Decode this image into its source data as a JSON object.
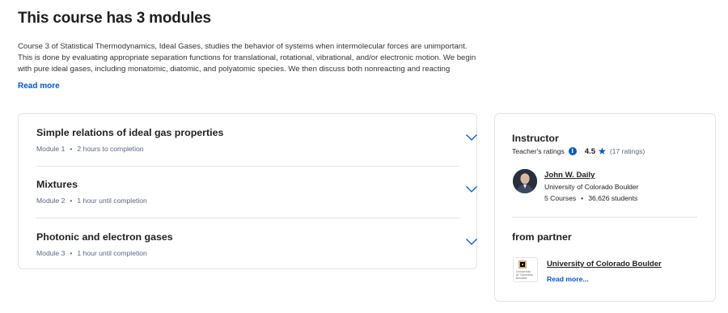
{
  "heading": {
    "title": "This course has 3 modules"
  },
  "description": {
    "text": "Course 3 of Statistical Thermodynamics, Ideal Gases, studies the behavior of systems when intermolecular forces are unimportant. This is done by evaluating appropriate separation functions for translational, rotational, vibrational, and/or electronic motion. We begin with pure ideal gases, including monatomic, diatomic, and polyatomic species. We then discuss both nonreacting and reacting mixtures of",
    "read_more": "Read more"
  },
  "modules": [
    {
      "title": "Simple relations of ideal gas properties",
      "number": "Module 1",
      "duration": "2 hours to completion"
    },
    {
      "title": "Mixtures",
      "number": "Module 2",
      "duration": "1 hour until completion"
    },
    {
      "title": "Photonic and electron gases",
      "number": "Module 3",
      "duration": "1 hour until completion"
    }
  ],
  "meta_separator": "•",
  "instructor": {
    "heading": "Instructor",
    "ratings_label": "Teacher's ratings",
    "rating_value": "4.5",
    "rating_count": "(17 ratings)",
    "name": "John W. Daily",
    "organization": "University of Colorado Boulder",
    "courses": "5 Courses",
    "students": "36,626 students"
  },
  "partner": {
    "heading": "from partner",
    "name": "University of Colorado Boulder",
    "read_more": "Read more...",
    "logo_line1": "University",
    "logo_line2": "of Colorado",
    "logo_line3": "Boulder"
  },
  "icons": {
    "chevron": "chevron-down-icon",
    "info": "info-icon",
    "star": "star-icon"
  },
  "colors": {
    "accent": "#0056d2",
    "text": "#1f1f1f",
    "muted": "#5b6780",
    "border": "#e1e3e6",
    "logo_gold": "#cfb87c"
  }
}
